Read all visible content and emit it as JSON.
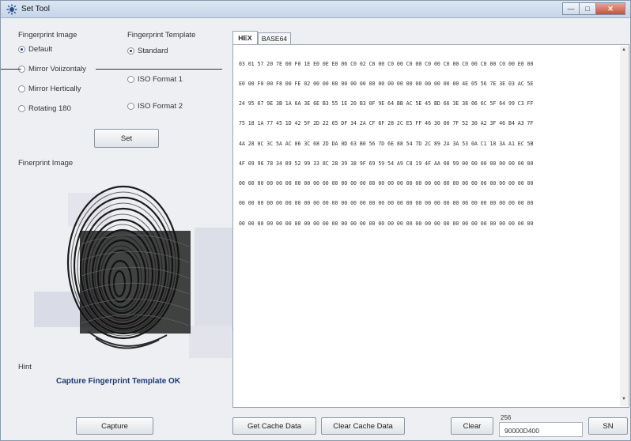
{
  "window": {
    "title": "Set Tool"
  },
  "fingerprint_image": {
    "label": "Fingerprint Image",
    "options": [
      {
        "label": "Default",
        "selected": true
      },
      {
        "label": "Mirror Voiizontaly",
        "selected": false
      },
      {
        "label": "Mirror Hertically",
        "selected": false
      },
      {
        "label": "Rotating 180",
        "selected": false
      }
    ]
  },
  "fingerprint_template": {
    "label": "Fingerprint Template",
    "options": [
      {
        "label": "Standard",
        "selected": true
      },
      {
        "label": "ISO Format 1",
        "selected": false
      },
      {
        "label": "ISO Format 2",
        "selected": false
      }
    ]
  },
  "set_button": "Set",
  "image_section_label": "Finerprint Image",
  "hint": {
    "label": "Hint",
    "text": "Capture Fingerprint Template OK"
  },
  "capture_button": "Capture",
  "tabs": [
    {
      "label": "HEX",
      "active": true
    },
    {
      "label": "BASE64",
      "active": false
    }
  ],
  "hex_lines": [
    "03 01 57 20 7E 00 F0 1E E0 0E E0 06 C0 02 C0 00 C0 00 C0 00 C0 00 C0 00 C0 00 C0 00 C0 00 E0 00",
    "E0 00 F0 00 F8 00 FE 02 00 00 00 00 00 00 00 00 00 00 00 00 00 00 00 00 4E 05 56 7E 3E 03 AC 5E",
    "24 95 67 9E 3B 1A 6A 3E 6E B3 55 1E 20 B3 0F 9E 64 BB AC 5E 45 BD 66 3E 38 06 6C 5F 64 99 C3 FF",
    "75 18 1A 77 45 1D 42 5F 2D 22 65 DF 34 2A CF 8F 28 2C E5 FF 46 30 00 7F 52 30 A2 3F 46 B4 A3 7F",
    "4A 28 0C 3C 5A AC 06 3C 68 2D DA 0D 63 B0 56 7D 6E 88 54 7D 2C 89 2A 3A 53 0A C1 18 3A A1 EC 5B",
    "4F 09 96 78 34 89 52 99 33 8C 28 39 38 9F 69 59 54 A9 C8 19 4F AA 08 99 00 00 00 00 00 00 00 00",
    "00 00 00 00 00 00 00 00 00 00 00 00 00 00 00 00 00 00 00 00 00 00 00 00 00 00 00 00 00 00 00 00",
    "00 00 00 00 00 00 00 00 00 00 00 00 00 00 00 00 00 00 00 00 00 00 00 00 00 00 00 00 00 00 00 00",
    "00 00 00 00 00 00 00 00 00 00 00 00 00 00 00 00 00 00 00 00 00 00 00 00 00 00 00 00 00 00 00 00"
  ],
  "bottom": {
    "get_cache": "Get Cache Data",
    "clear_cache": "Clear Cache Data",
    "clear": "Clear",
    "count": "256",
    "input_value": "90000D400",
    "sn": "SN"
  },
  "icons": [
    "app-icon",
    "minimize-icon",
    "maximize-icon",
    "close-icon",
    "fingerprint-image"
  ]
}
